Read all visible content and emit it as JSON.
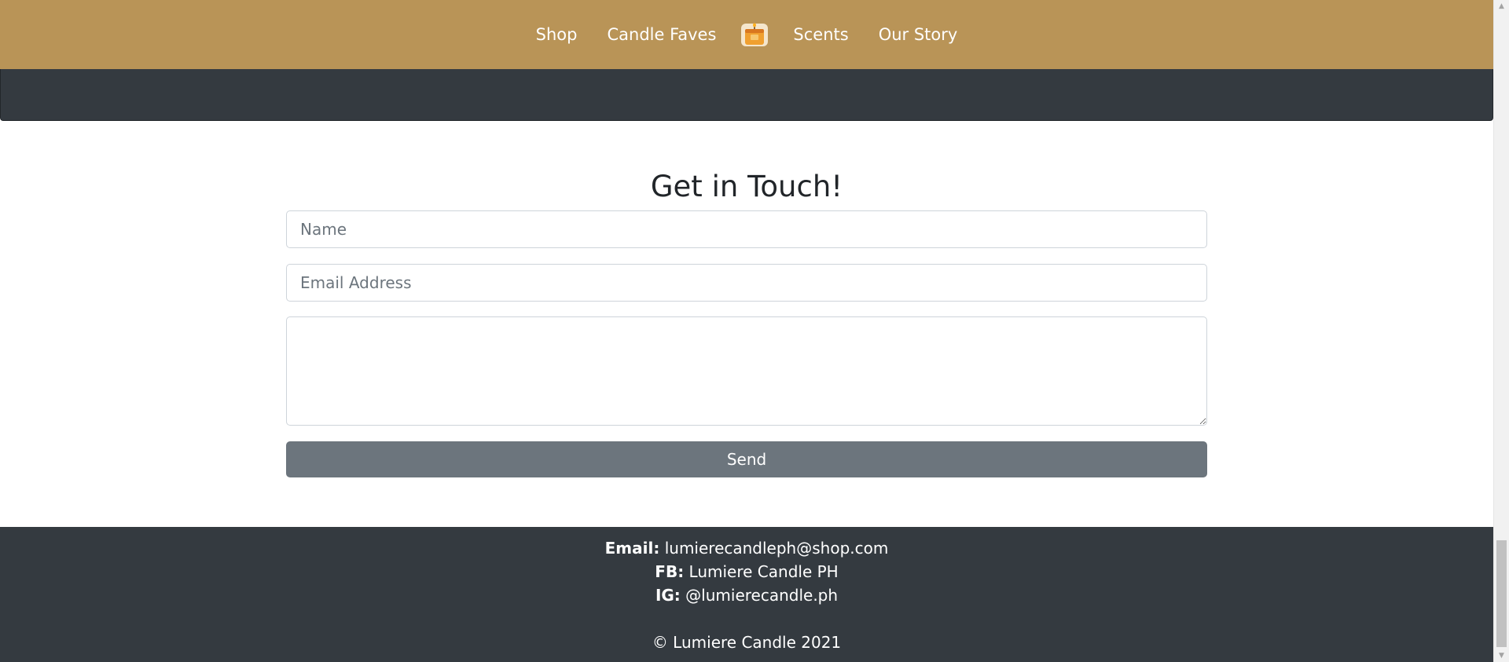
{
  "nav": {
    "items": [
      {
        "label": "Shop"
      },
      {
        "label": "Candle Faves"
      },
      {
        "label": "Scents"
      },
      {
        "label": "Our Story"
      }
    ],
    "logo_icon": "candle-logo-icon",
    "bg_color": "#b99457"
  },
  "contact": {
    "title": "Get in Touch!",
    "name_placeholder": "Name",
    "email_placeholder": "Email Address",
    "message_value": "",
    "send_label": "Send"
  },
  "footer": {
    "email_label": "Email:",
    "email_value": " lumierecandleph@shop.com",
    "fb_label": "FB:",
    "fb_value": " Lumiere Candle PH",
    "ig_label": "IG:",
    "ig_value": " @lumierecandle.ph",
    "copyright": "© Lumiere Candle 2021",
    "bg_color": "#343a40"
  }
}
